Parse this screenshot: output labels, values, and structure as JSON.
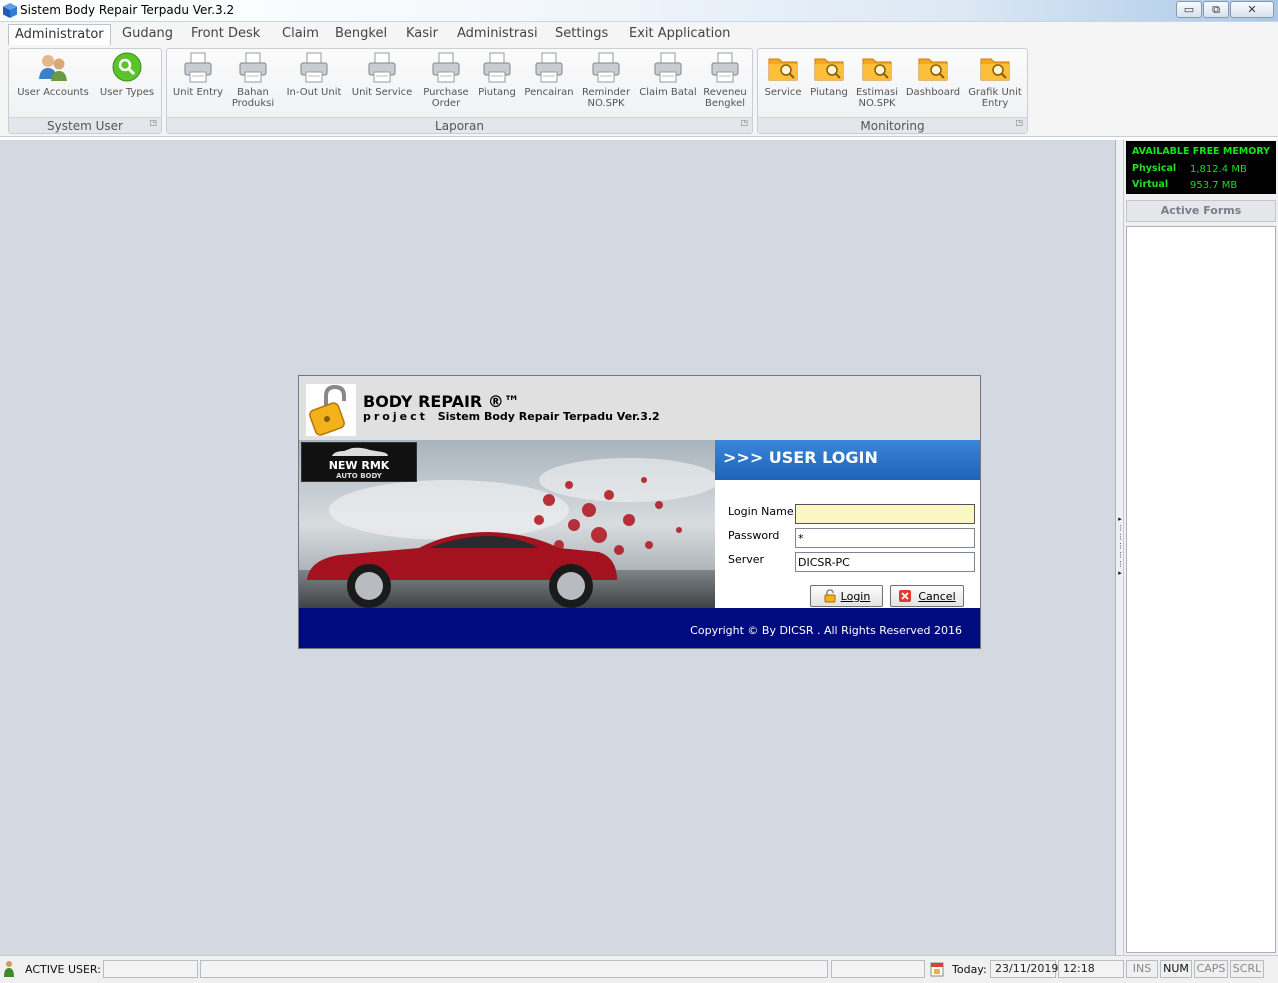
{
  "window": {
    "title": "Sistem Body Repair Terpadu Ver.3.2",
    "minimize_label": "▭",
    "restore_label": "⧉",
    "close_label": "✕"
  },
  "menu": [
    {
      "label": "Administrator",
      "active": true
    },
    {
      "label": "Gudang"
    },
    {
      "label": "Front Desk"
    },
    {
      "label": "Claim"
    },
    {
      "label": "Bengkel"
    },
    {
      "label": "Kasir"
    },
    {
      "label": "Administrasi"
    },
    {
      "label": "Settings"
    },
    {
      "label": "Exit Application"
    }
  ],
  "ribbon": {
    "system_user": {
      "label": "System User",
      "buttons": [
        {
          "label": "User Accounts",
          "icon": "users-icon"
        },
        {
          "label": "User Types",
          "icon": "search-icon"
        }
      ]
    },
    "laporan": {
      "label": "Laporan",
      "buttons": [
        {
          "label1": "Unit Entry",
          "label2": "",
          "icon": "printer-icon"
        },
        {
          "label1": "Bahan",
          "label2": "Produksi",
          "icon": "printer-icon"
        },
        {
          "label1": "In-Out Unit",
          "label2": "",
          "icon": "printer-icon"
        },
        {
          "label1": "Unit Service",
          "label2": "",
          "icon": "printer-icon"
        },
        {
          "label1": "Purchase",
          "label2": "Order",
          "icon": "printer-icon"
        },
        {
          "label1": "Piutang",
          "label2": "",
          "icon": "printer-icon"
        },
        {
          "label1": "Pencairan",
          "label2": "",
          "icon": "printer-icon"
        },
        {
          "label1": "Reminder",
          "label2": "NO.SPK",
          "icon": "printer-icon"
        },
        {
          "label1": "Claim Batal",
          "label2": "",
          "icon": "printer-icon"
        },
        {
          "label1": "Reveneu",
          "label2": "Bengkel",
          "icon": "printer-icon"
        }
      ]
    },
    "monitoring": {
      "label": "Monitoring",
      "buttons": [
        {
          "label1": "Service",
          "label2": "",
          "icon": "folder-search-icon"
        },
        {
          "label1": "Piutang",
          "label2": "",
          "icon": "folder-search-icon"
        },
        {
          "label1": "Estimasi",
          "label2": "NO.SPK",
          "icon": "folder-search-icon"
        },
        {
          "label1": "Dashboard",
          "label2": "",
          "icon": "folder-search-icon"
        },
        {
          "label1": "Grafik Unit",
          "label2": "Entry",
          "icon": "folder-search-icon"
        }
      ]
    }
  },
  "memory": {
    "title": "AVAILABLE FREE MEMORY",
    "physical_label": "Physical",
    "physical_value": "1,812.4 MB",
    "virtual_label": "Virtual",
    "virtual_value": "953.7 MB"
  },
  "active_forms": {
    "header": "Active Forms"
  },
  "login": {
    "brand": "BODY REPAIR ®™",
    "project_prefix": "project",
    "project_name": "Sistem Body Repair Terpadu Ver.3.2",
    "logo_line1": "NEW RMK",
    "logo_line2": "AUTO BODY",
    "header": ">>> USER LOGIN",
    "login_name_label": "Login Name",
    "login_name_value": "",
    "password_label": "Password",
    "password_value": "*",
    "server_label": "Server",
    "server_value": "DICSR-PC",
    "login_button": "Login",
    "cancel_button": "Cancel",
    "copyright": "Copyright © By DICSR . All Rights Reserved 2016"
  },
  "statusbar": {
    "active_user_label": "ACTIVE USER:",
    "active_user_value": "",
    "today_label": "Today:",
    "date": "23/11/2019",
    "time": "12:18",
    "keys": [
      {
        "label": "INS",
        "on": false
      },
      {
        "label": "NUM",
        "on": true
      },
      {
        "label": "CAPS",
        "on": false
      },
      {
        "label": "SCRL",
        "on": false
      }
    ]
  },
  "colors": {
    "workspace": "#d4d8e0",
    "login_header": "#2a74c8",
    "footer": "#000b7f",
    "memory_text": "#00ff00"
  }
}
